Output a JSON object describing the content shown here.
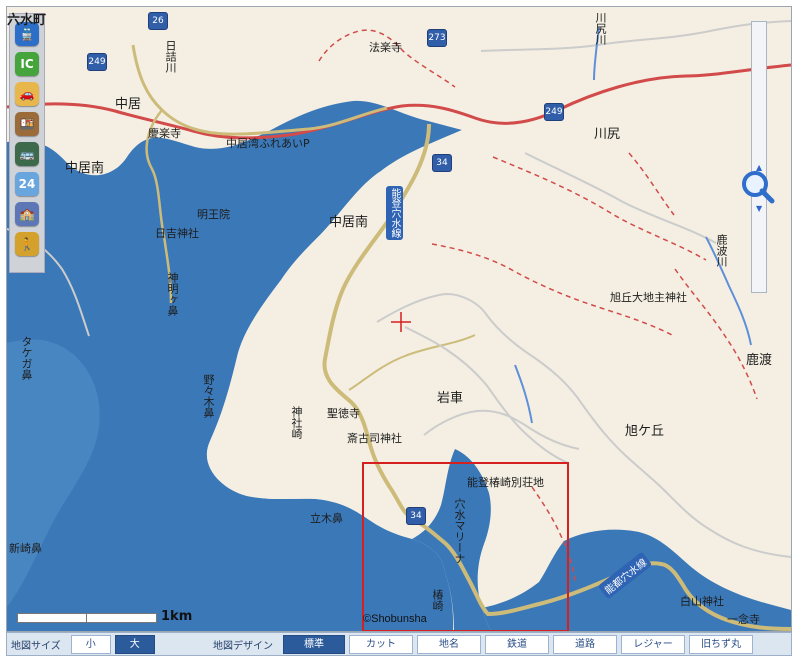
{
  "map": {
    "place_labels": [
      {
        "key": "rokusui_town",
        "text": "六水町"
      },
      {
        "key": "nakai",
        "text": "中居"
      },
      {
        "key": "nakai_minami_w",
        "text": "中居南"
      },
      {
        "key": "nakai_minami_c",
        "text": "中居南"
      },
      {
        "key": "kawajiri",
        "text": "川尻"
      },
      {
        "key": "iwaguruma",
        "text": "岩車"
      },
      {
        "key": "rokudo",
        "text": "鹿渡"
      },
      {
        "key": "asahigaoka",
        "text": "旭ケ丘"
      },
      {
        "key": "tachigibana",
        "text": "立木鼻"
      },
      {
        "key": "shinzakibana",
        "text": "新崎鼻"
      },
      {
        "key": "tsubakizaki",
        "text": "椿崎"
      }
    ],
    "poi_labels": [
      {
        "key": "hojoji",
        "text": "法楽寺"
      },
      {
        "key": "keirakuji",
        "text": "慶楽寺"
      },
      {
        "key": "myooin",
        "text": "明王院"
      },
      {
        "key": "hiyoshi",
        "text": "日吉神社"
      },
      {
        "key": "shinmeigahana",
        "text": "神明ヶ鼻"
      },
      {
        "key": "fureai",
        "text": "中居湾ふれあいP"
      },
      {
        "key": "asahigaoka_jinja",
        "text": "旭丘大地主神社"
      },
      {
        "key": "nonoki",
        "text": "野々木鼻"
      },
      {
        "key": "jinjazaki",
        "text": "神社崎"
      },
      {
        "key": "shotokuji",
        "text": "聖徳寺"
      },
      {
        "key": "shinjinja",
        "text": "斎古司神社"
      },
      {
        "key": "notobessou",
        "text": "能登椿崎別荘地"
      },
      {
        "key": "marina",
        "text": "穴水マリーナ"
      },
      {
        "key": "hakusan",
        "text": "白山神社"
      },
      {
        "key": "ichinenji",
        "text": "一念寺"
      },
      {
        "key": "takenogabana",
        "text": "タケガ鼻"
      },
      {
        "key": "kamogawa",
        "text": "鹿波川"
      },
      {
        "key": "kawajiri_river",
        "text": "川尻川"
      },
      {
        "key": "higashida_river",
        "text": "日詰川"
      },
      {
        "key": "road_sign_1",
        "text": "能登穴水線"
      },
      {
        "key": "road_sign_2",
        "text": "能都穴水線"
      }
    ],
    "route_markers": [
      "26",
      "249",
      "273",
      "249",
      "34",
      "34"
    ],
    "scale_label": "1km",
    "credit": "©Shobunsha"
  },
  "toolbar_left": {
    "icons": [
      "train-icon",
      "ic-icon",
      "car-icon",
      "bento-icon",
      "bus-icon",
      "calendar-icon",
      "station-icon",
      "walking-icon"
    ]
  },
  "bottom_bar": {
    "size_label": "地図サイズ",
    "size_small": "小",
    "size_large": "大",
    "design_label": "地図デザイン",
    "design_buttons": [
      "標準",
      "カット",
      "地名",
      "鉄道",
      "道路",
      "レジャー",
      "旧ちず丸"
    ]
  },
  "colors": {
    "sea": "#3b78b8",
    "land": "#f4efe2",
    "road_major": "#d24a4a",
    "road_secondary": "#cdbb7a",
    "river": "#5f8fd9",
    "selection": "#d61f1f",
    "zoom_accent": "#2f6fcb"
  }
}
